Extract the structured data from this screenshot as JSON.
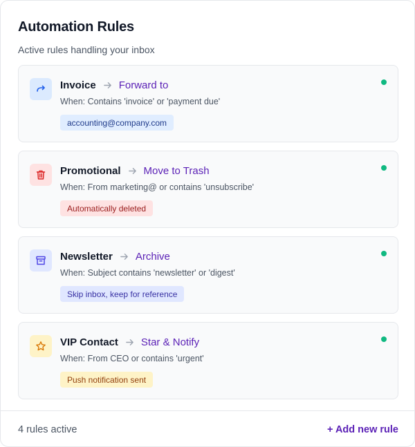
{
  "header": {
    "title": "Automation Rules",
    "subtitle": "Active rules handling your inbox"
  },
  "rules": [
    {
      "name": "Invoice",
      "action": "Forward to",
      "condition": "When: Contains 'invoice' or 'payment due'",
      "tag": "accounting@company.com",
      "icon": "forward-arrow-icon",
      "colors": {
        "icon_bg": "#dbeafe",
        "icon_fg": "#2563eb",
        "tag_bg": "#e0edff",
        "tag_fg": "#1e3a8a"
      }
    },
    {
      "name": "Promotional",
      "action": "Move to Trash",
      "condition": "When: From marketing@ or contains 'unsubscribe'",
      "tag": "Automatically deleted",
      "icon": "trash-icon",
      "colors": {
        "icon_bg": "#fee2e2",
        "icon_fg": "#dc2626",
        "tag_bg": "#fee2e2",
        "tag_fg": "#991b1b"
      }
    },
    {
      "name": "Newsletter",
      "action": "Archive",
      "condition": "When: Subject contains 'newsletter' or 'digest'",
      "tag": "Skip inbox, keep for reference",
      "icon": "archive-box-icon",
      "colors": {
        "icon_bg": "#e0e7ff",
        "icon_fg": "#4f46e5",
        "tag_bg": "#e0e7ff",
        "tag_fg": "#3730a3"
      }
    },
    {
      "name": "VIP Contact",
      "action": "Star & Notify",
      "condition": "When: From CEO or contains 'urgent'",
      "tag": "Push notification sent",
      "icon": "star-icon",
      "colors": {
        "icon_bg": "#fef3c7",
        "icon_fg": "#d97706",
        "tag_bg": "#fef3c7",
        "tag_fg": "#92400e"
      }
    }
  ],
  "status_color": "#10b981",
  "footer": {
    "count": "4 rules active",
    "add_label": "+ Add new rule"
  }
}
